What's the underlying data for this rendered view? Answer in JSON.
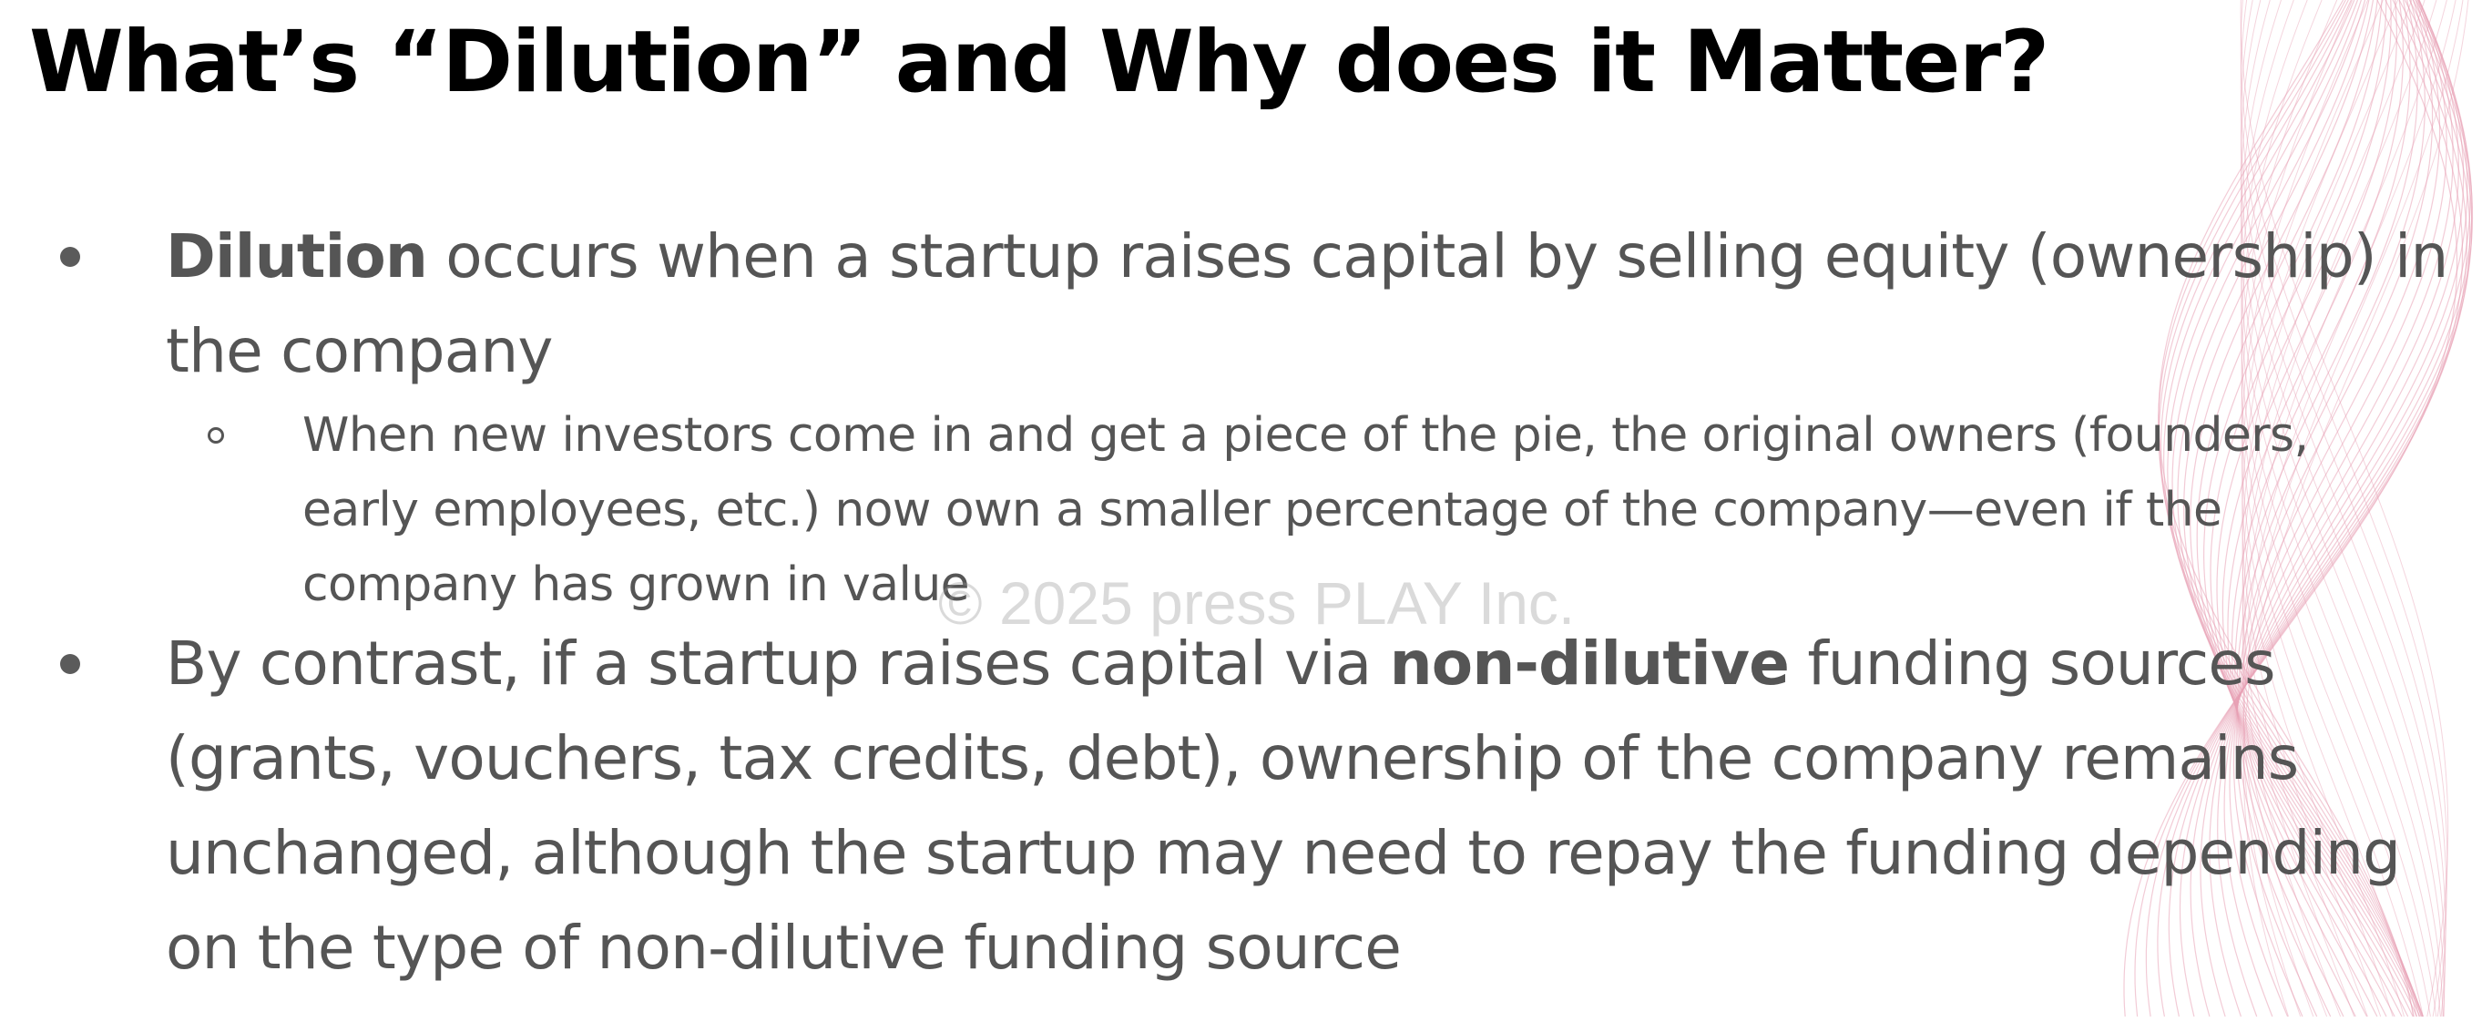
{
  "slide": {
    "title": "What’s “Dilution” and Why does it Matter?",
    "bullets": [
      {
        "bold_lead": "Dilution",
        "text_after": " occurs when a startup raises capital by selling equity (ownership) in the company",
        "sub_bullets": [
          {
            "text": "When new investors come in and get a piece of the pie, the original owners (founders, early employees, etc.) now own a smaller percentage of the company—even if the company has grown in value"
          }
        ]
      },
      {
        "text_before": "By contrast, if a startup raises capital via ",
        "bold_mid": "non-dilutive",
        "text_after": " funding sources (grants, vouchers, tax credits, debt), ownership of the company remains unchanged, although the startup may need to repay the funding depending on the type of non-dilutive funding source"
      }
    ],
    "watermark": "© 2025 press PLAY Inc."
  },
  "colors": {
    "title": "#000000",
    "body_text": "#555555",
    "decoration": "#e7a0b4",
    "watermark": "#969696"
  },
  "icons": {
    "bullet": "filled-circle-bullet",
    "sub_bullet": "hollow-circle-bullet",
    "decoration": "wave-line-pattern"
  }
}
